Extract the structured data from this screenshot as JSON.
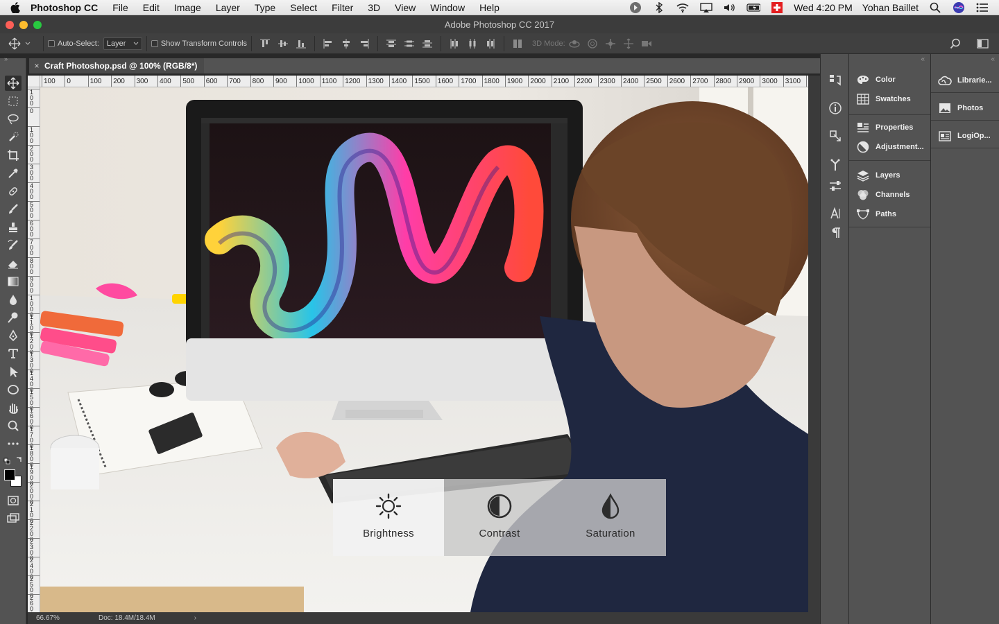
{
  "menubar": {
    "app_name": "Photoshop CC",
    "items": [
      "File",
      "Edit",
      "Image",
      "Layer",
      "Type",
      "Select",
      "Filter",
      "3D",
      "View",
      "Window",
      "Help"
    ],
    "clock": "Wed 4:20 PM",
    "user": "Yohan Baillet"
  },
  "window": {
    "title": "Adobe Photoshop CC 2017"
  },
  "options": {
    "auto_select_label": "Auto-Select:",
    "auto_select_value": "Layer",
    "transform_label": "Show Transform Controls",
    "mode_3d_label": "3D Mode:"
  },
  "document": {
    "tab_title": "Craft Photoshop.psd @ 100% (RGB/8*)"
  },
  "ruler": {
    "h_labels": [
      "100",
      "0",
      "100",
      "200",
      "300",
      "400",
      "500",
      "600",
      "700",
      "800",
      "900",
      "1000",
      "1100",
      "1200",
      "1300",
      "1400",
      "1500",
      "1600",
      "1700",
      "1800",
      "1900",
      "2000",
      "2100",
      "2200",
      "2300",
      "2400",
      "2500",
      "2600",
      "2700",
      "2800",
      "2900",
      "3000",
      "3100",
      "3"
    ],
    "v_labels": [
      "1 0 0",
      "0",
      "1 0 0",
      "2 0 0",
      "3 0 0",
      "4 0 0",
      "5 0 0",
      "6 0 0",
      "7 0 0",
      "8 0 0",
      "9 0 0",
      "1 0 0 0",
      "1 1 0 0",
      "1 2 0 0",
      "1 3 0 0",
      "1 4 0 0",
      "1 5 0 0",
      "1 6 0 0",
      "1 7 0 0",
      "1 8 0 0",
      "1 9 0 0",
      "2 0 0 0",
      "2 1 0 0",
      "2 2 0 0",
      "2 3 0 0",
      "2 4 0 0",
      "2 5 0 0",
      "2 6 0 0"
    ]
  },
  "status": {
    "zoom": "66.67%",
    "doc": "Doc: 18.4M/18.4M"
  },
  "overlay": {
    "brightness": "Brightness",
    "contrast": "Contrast",
    "saturation": "Saturation"
  },
  "panels": {
    "col1": [
      "Color",
      "Swatches",
      "Properties",
      "Adjustment...",
      "Layers",
      "Channels",
      "Paths"
    ],
    "col2": [
      "Librarie...",
      "Photos",
      "LogiOp..."
    ]
  }
}
